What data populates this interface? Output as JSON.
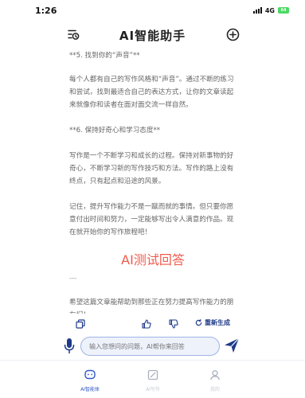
{
  "status_bar": {
    "time": "1:26",
    "network": "4G",
    "battery": "64"
  },
  "nav": {
    "title": "AI智能助手",
    "left_icon": "history-list-icon",
    "right_icon": "plus-circle-icon"
  },
  "content": {
    "paragraphs": [
      "**5. 找到你的“声音”**",
      "每个人都有自己的写作风格和“声音”。通过不断的练习和尝试，找到最适合自己的表达方式，让你的文章读起来就像你和读者在面对面交流一样自然。",
      "**6. 保持好奇心和学习态度**",
      "写作是一个不断学习和成长的过程。保持对新事物的好奇心，不断学习新的写作技巧和方法。写作的路上没有终点，只有起点和沿途的风景。",
      "记住，提升写作能力不是一蹴而就的事情。但只要你愿意付出时间和努力，一定能够写出令人满意的作品。现在就开始你的写作旅程吧！"
    ],
    "answer_heading": "AI测试回答",
    "separator": "---",
    "closing": "希望这篇文章能帮助到那些正在努力提高写作能力的朋友们！"
  },
  "actions": {
    "regenerate_label": "重新生成",
    "accent": "#1e3a8a"
  },
  "input": {
    "placeholder": "输入您想问的问题，AI帮你来回答"
  },
  "tabs": [
    {
      "label": "AI智能体",
      "icon": "chat-bubble-icon",
      "active": true
    },
    {
      "label": "AI写作",
      "icon": "edit-note-icon",
      "active": false
    },
    {
      "label": "我的",
      "icon": "user-icon",
      "active": false
    }
  ],
  "colors": {
    "accent_blue": "#2f58c9",
    "heading_red": "#f05a4b",
    "battery_green": "#4cd964"
  }
}
